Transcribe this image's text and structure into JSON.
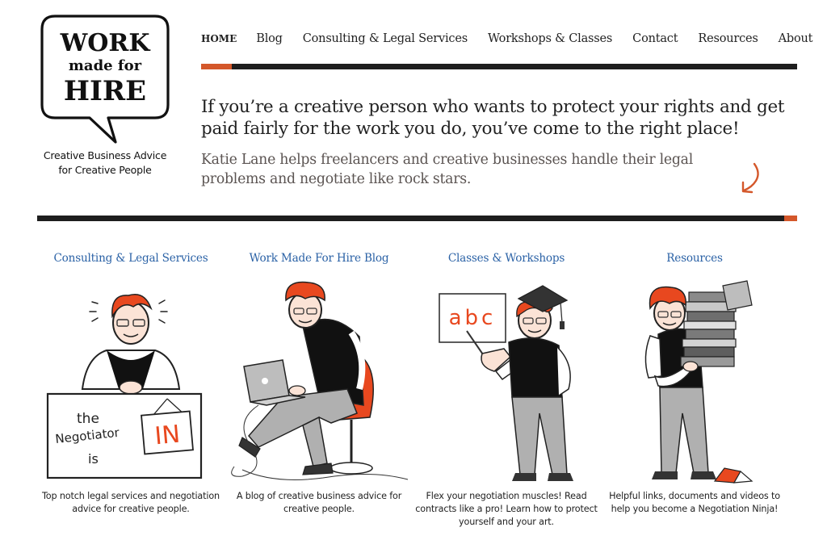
{
  "site": {
    "logo": {
      "line1": "WORK",
      "line2": "made for",
      "line3": "HIRE",
      "tagline_line1": "Creative Business Advice",
      "tagline_line2": "for Creative People"
    },
    "colors": {
      "accent": "#d4572a",
      "bar": "#1e1e1e",
      "link": "#2b62a6",
      "subtext": "#5b5452"
    }
  },
  "nav": {
    "items": [
      {
        "label": "HOME",
        "active": true
      },
      {
        "label": "Blog"
      },
      {
        "label": "Consulting & Legal Services"
      },
      {
        "label": "Workshops & Classes"
      },
      {
        "label": "Contact"
      },
      {
        "label": "Resources"
      },
      {
        "label": "About"
      }
    ]
  },
  "hero": {
    "title": "If you’re a creative person who wants to protect your rights and get paid fairly for the work you do, you’ve come to the right place!",
    "subtitle": "Katie Lane helps freelancers and creative businesses handle their legal problems and negotiate like rock stars.",
    "arrow_icon": "curved-arrow-down"
  },
  "features": [
    {
      "title": "Consulting & Legal Services",
      "illustration": "negotiator-at-desk",
      "sign_text": [
        "the",
        "Negotiator",
        "is"
      ],
      "sign_badge": "IN",
      "description": "Top notch legal services and negotiation advice for creative people."
    },
    {
      "title": "Work Made For Hire Blog",
      "illustration": "person-with-laptop-on-chair",
      "description": "A blog of creative business advice for creative people."
    },
    {
      "title": "Classes & Workshops",
      "illustration": "teacher-with-board",
      "board_text": "abc",
      "description": "Flex your negotiation muscles! Read contracts like a pro! Learn how to protect yourself and your art."
    },
    {
      "title": "Resources",
      "illustration": "person-carrying-books",
      "description": "Helpful links, documents and videos to help you become a Negotiation Ninja!"
    }
  ]
}
